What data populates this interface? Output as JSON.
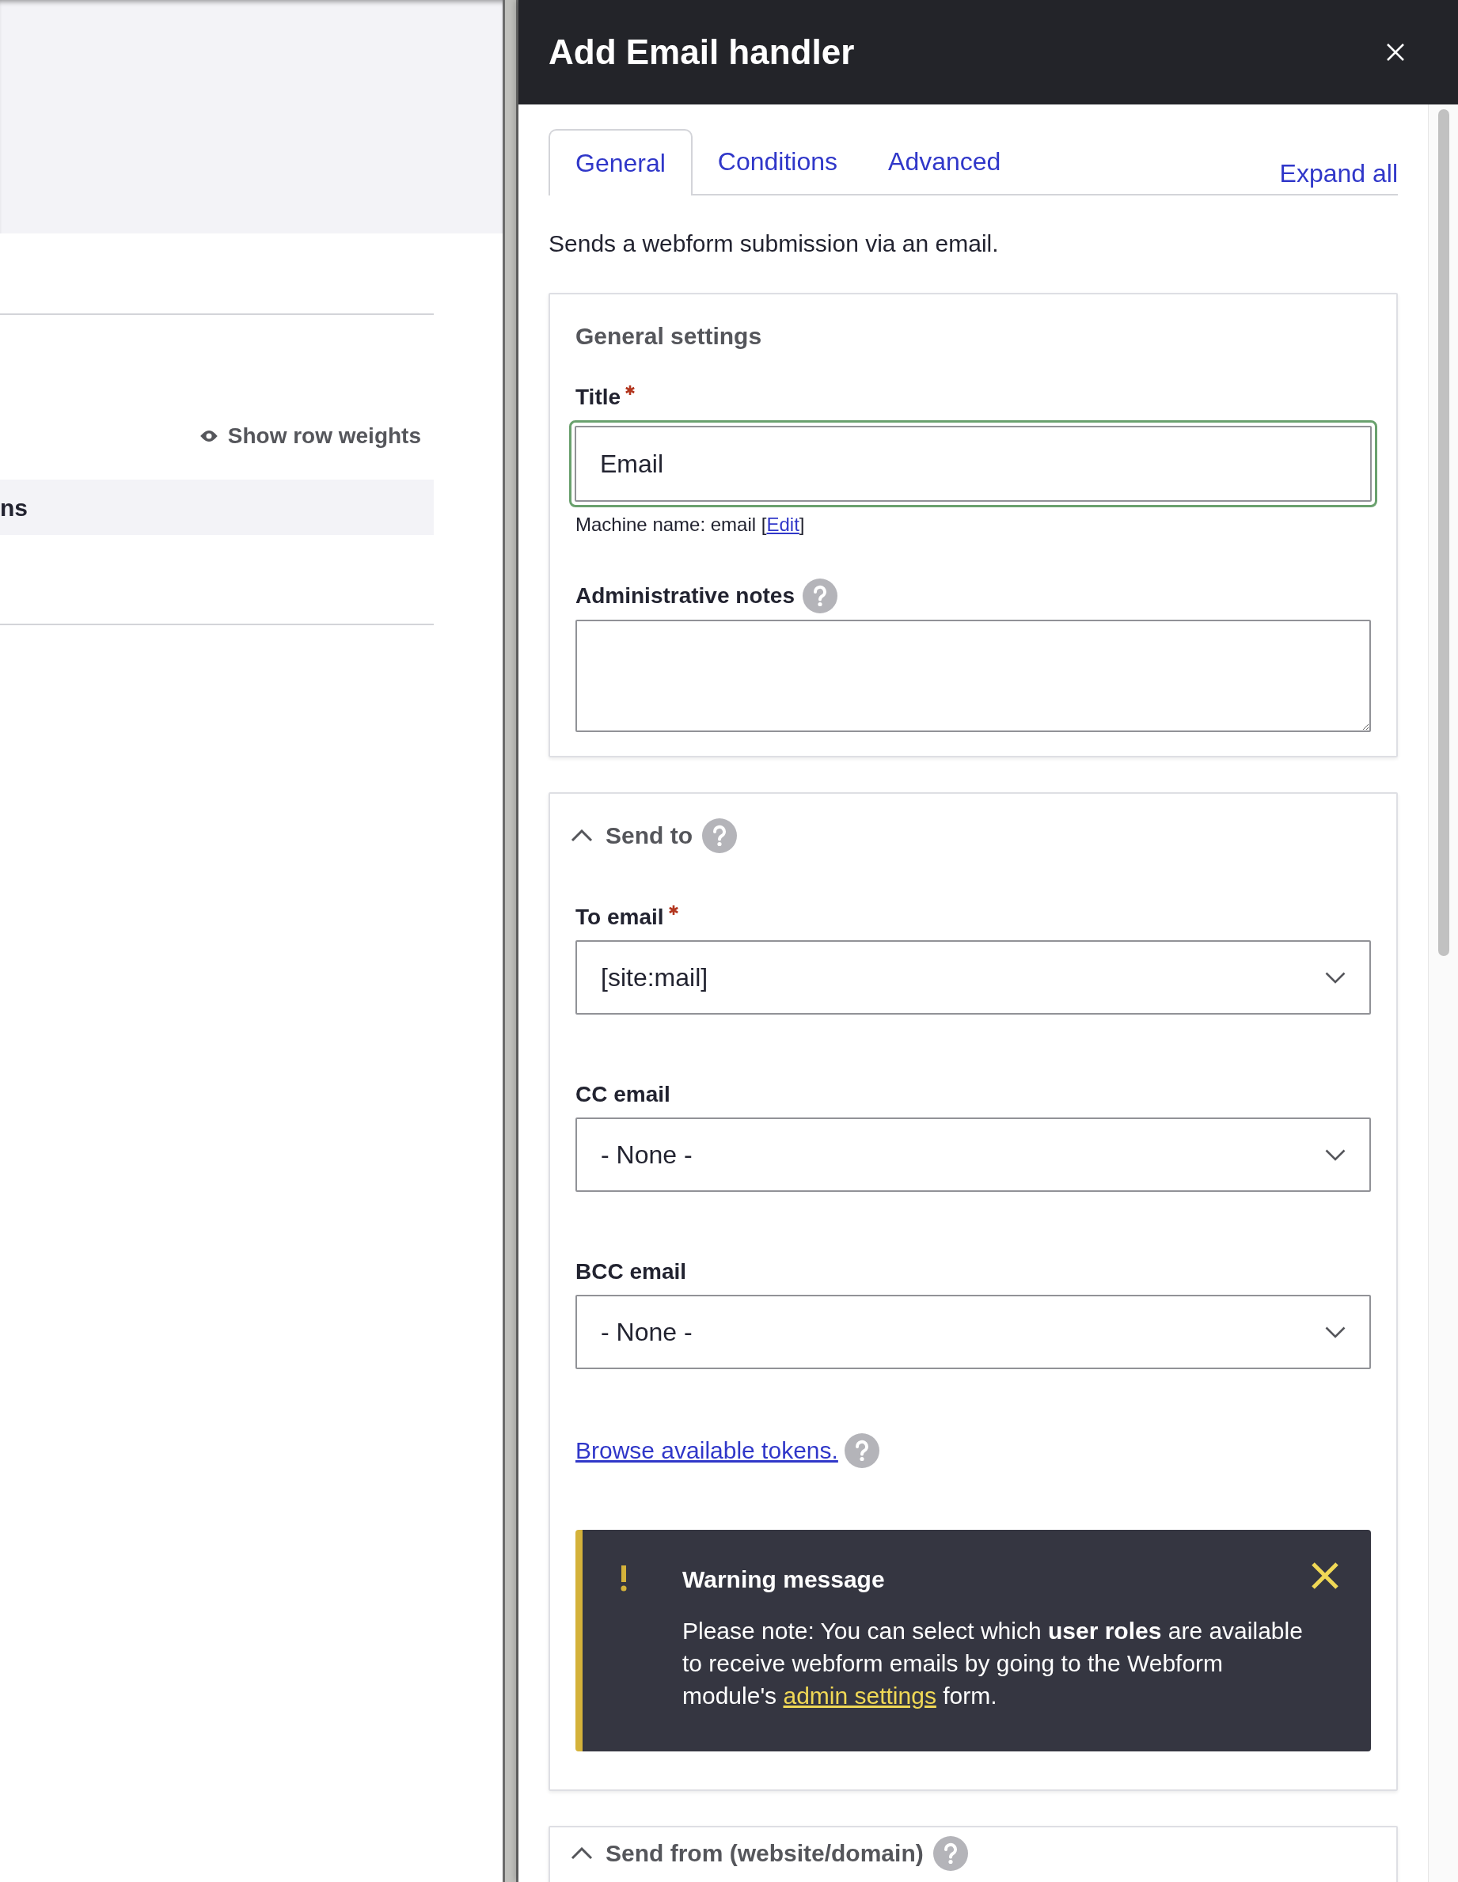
{
  "background_page": {
    "toggle_link": "Show row weights",
    "row_fragment": "ns"
  },
  "dialog": {
    "title": "Add Email handler",
    "tabs": [
      {
        "label": "General",
        "selected": true
      },
      {
        "label": "Conditions",
        "selected": false
      },
      {
        "label": "Advanced",
        "selected": false
      }
    ],
    "expand_all": "Expand all",
    "description": "Sends a webform submission via an email.",
    "sections": [
      {
        "kind": "fieldset",
        "heading": "General settings",
        "fields": [
          {
            "kind": "text",
            "label": "Title",
            "required": true,
            "value": "Email",
            "focused": true
          },
          {
            "kind": "machine_name",
            "text": "Machine name: email [",
            "link": "Edit",
            "suffix": "]"
          },
          {
            "kind": "textarea",
            "label": "Administrative notes",
            "help": true
          }
        ]
      },
      {
        "kind": "details",
        "heading": "Send to",
        "expanded": true,
        "help": true,
        "fields": [
          {
            "kind": "select",
            "label": "To email",
            "required": true,
            "value": "[site:mail]"
          },
          {
            "kind": "select",
            "label": "CC email",
            "required": false,
            "value": "- None -"
          },
          {
            "kind": "select",
            "label": "BCC email",
            "required": false,
            "value": "- None -"
          },
          {
            "kind": "link",
            "text": "Browse available tokens.",
            "help": true
          },
          {
            "kind": "warning",
            "title": "Warning message",
            "message": "Please note: You can select which **user roles** are available to receive webform emails by going to the Webform module's",
            "link": "admin settings",
            "suffix": "form."
          }
        ]
      },
      {
        "kind": "details",
        "heading": "Send from (website/domain)",
        "expanded": true,
        "help": true
      }
    ]
  }
}
